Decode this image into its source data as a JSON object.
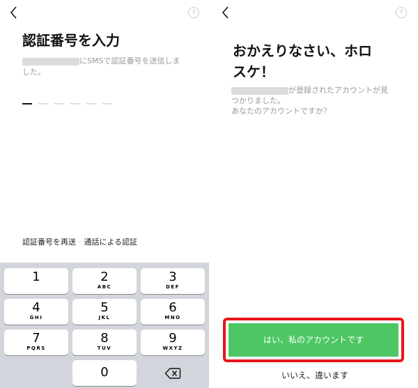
{
  "left_screen": {
    "title": "認証番号を入力",
    "sms_text_line1": "にSMSで認証番号を送信しま",
    "sms_text_line2": "した。",
    "help_label": "?",
    "resend_label": "認証番号を再送",
    "separator": "·",
    "call_label": "通話による認証",
    "keys": [
      {
        "num": "1",
        "letters": ""
      },
      {
        "num": "2",
        "letters": "ABC"
      },
      {
        "num": "3",
        "letters": "DEF"
      },
      {
        "num": "4",
        "letters": "GHI"
      },
      {
        "num": "5",
        "letters": "JKL"
      },
      {
        "num": "6",
        "letters": "MNO"
      },
      {
        "num": "7",
        "letters": "PQRS"
      },
      {
        "num": "8",
        "letters": "TUV"
      },
      {
        "num": "9",
        "letters": "WXYZ"
      },
      {
        "num": "0",
        "letters": ""
      }
    ]
  },
  "right_screen": {
    "title_line1": "おかえりなさい、ホロ",
    "title_line2": "スケ！",
    "desc_line1": "が登録されたアカウントが見",
    "desc_line2": "つかりました。",
    "desc_line3": "あなたのアカウントですか？",
    "help_label": "?",
    "yes_button": "はい、私のアカウントです",
    "no_button": "いいえ、違います"
  },
  "colors": {
    "accent_green": "#4cc764",
    "highlight_red": "#e8141a",
    "keypad_bg": "#d2d5db"
  },
  "icons": [
    "back-chevron-icon",
    "help-icon",
    "backspace-icon"
  ]
}
